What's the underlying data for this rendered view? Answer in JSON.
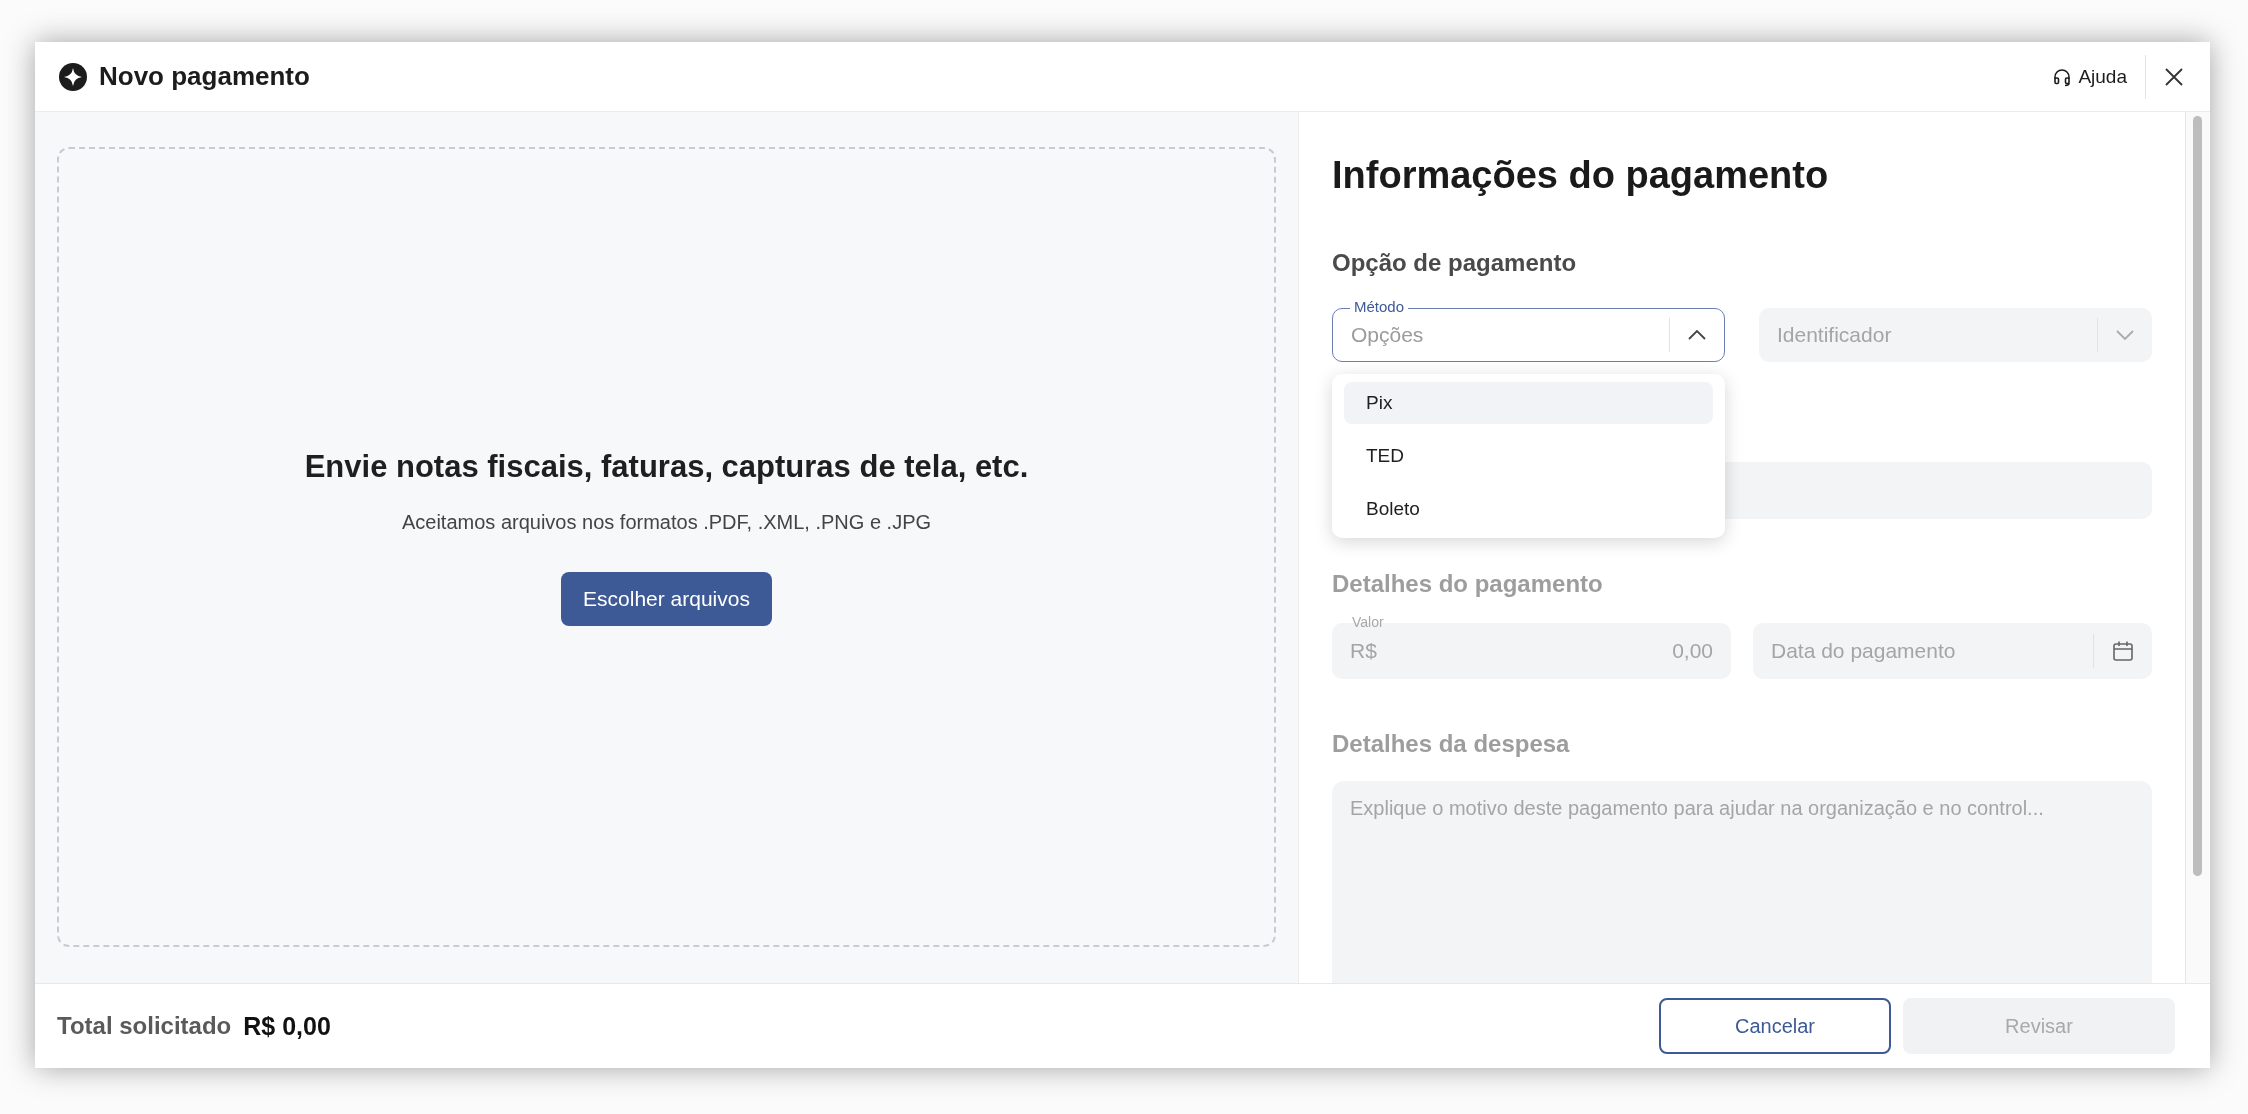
{
  "dialog": {
    "title": "Novo pagamento",
    "help_link": "Ajuda"
  },
  "upload": {
    "heading": "Envie notas fiscais, faturas, capturas de tela, etc.",
    "hint": "Aceitamos arquivos nos formatos .PDF, .XML, .PNG e .JPG",
    "button": "Escolher arquivos"
  },
  "form": {
    "title": "Informações do pagamento",
    "payment_option": {
      "heading": "Opção de pagamento",
      "disabled": false,
      "method": {
        "label": "Método",
        "placeholder": "Opções",
        "expanded": true,
        "options": [
          {
            "label": "Pix",
            "selected": true
          },
          {
            "label": "TED",
            "selected": false
          },
          {
            "label": "Boleto",
            "selected": false
          }
        ]
      },
      "identifier": {
        "placeholder": "Identificador",
        "disabled": true
      }
    },
    "payment_details": {
      "heading": "Detalhes do pagamento",
      "disabled": true,
      "amount": {
        "label": "Valor",
        "prefix": "R$",
        "placeholder": "0,00"
      },
      "date": {
        "placeholder": "Data do pagamento"
      }
    },
    "expense_details": {
      "heading": "Detalhes da despesa",
      "disabled": true,
      "description": {
        "placeholder": "Explique o motivo deste pagamento para ajudar na organização e no control..."
      }
    }
  },
  "footer": {
    "total_label": "Total solicitado",
    "total_value": "R$ 0,00",
    "buttons": [
      {
        "label": "Cancelar",
        "kind": "secondary",
        "disabled": false
      },
      {
        "label": "Revisar",
        "kind": "primary",
        "disabled": true
      }
    ]
  }
}
